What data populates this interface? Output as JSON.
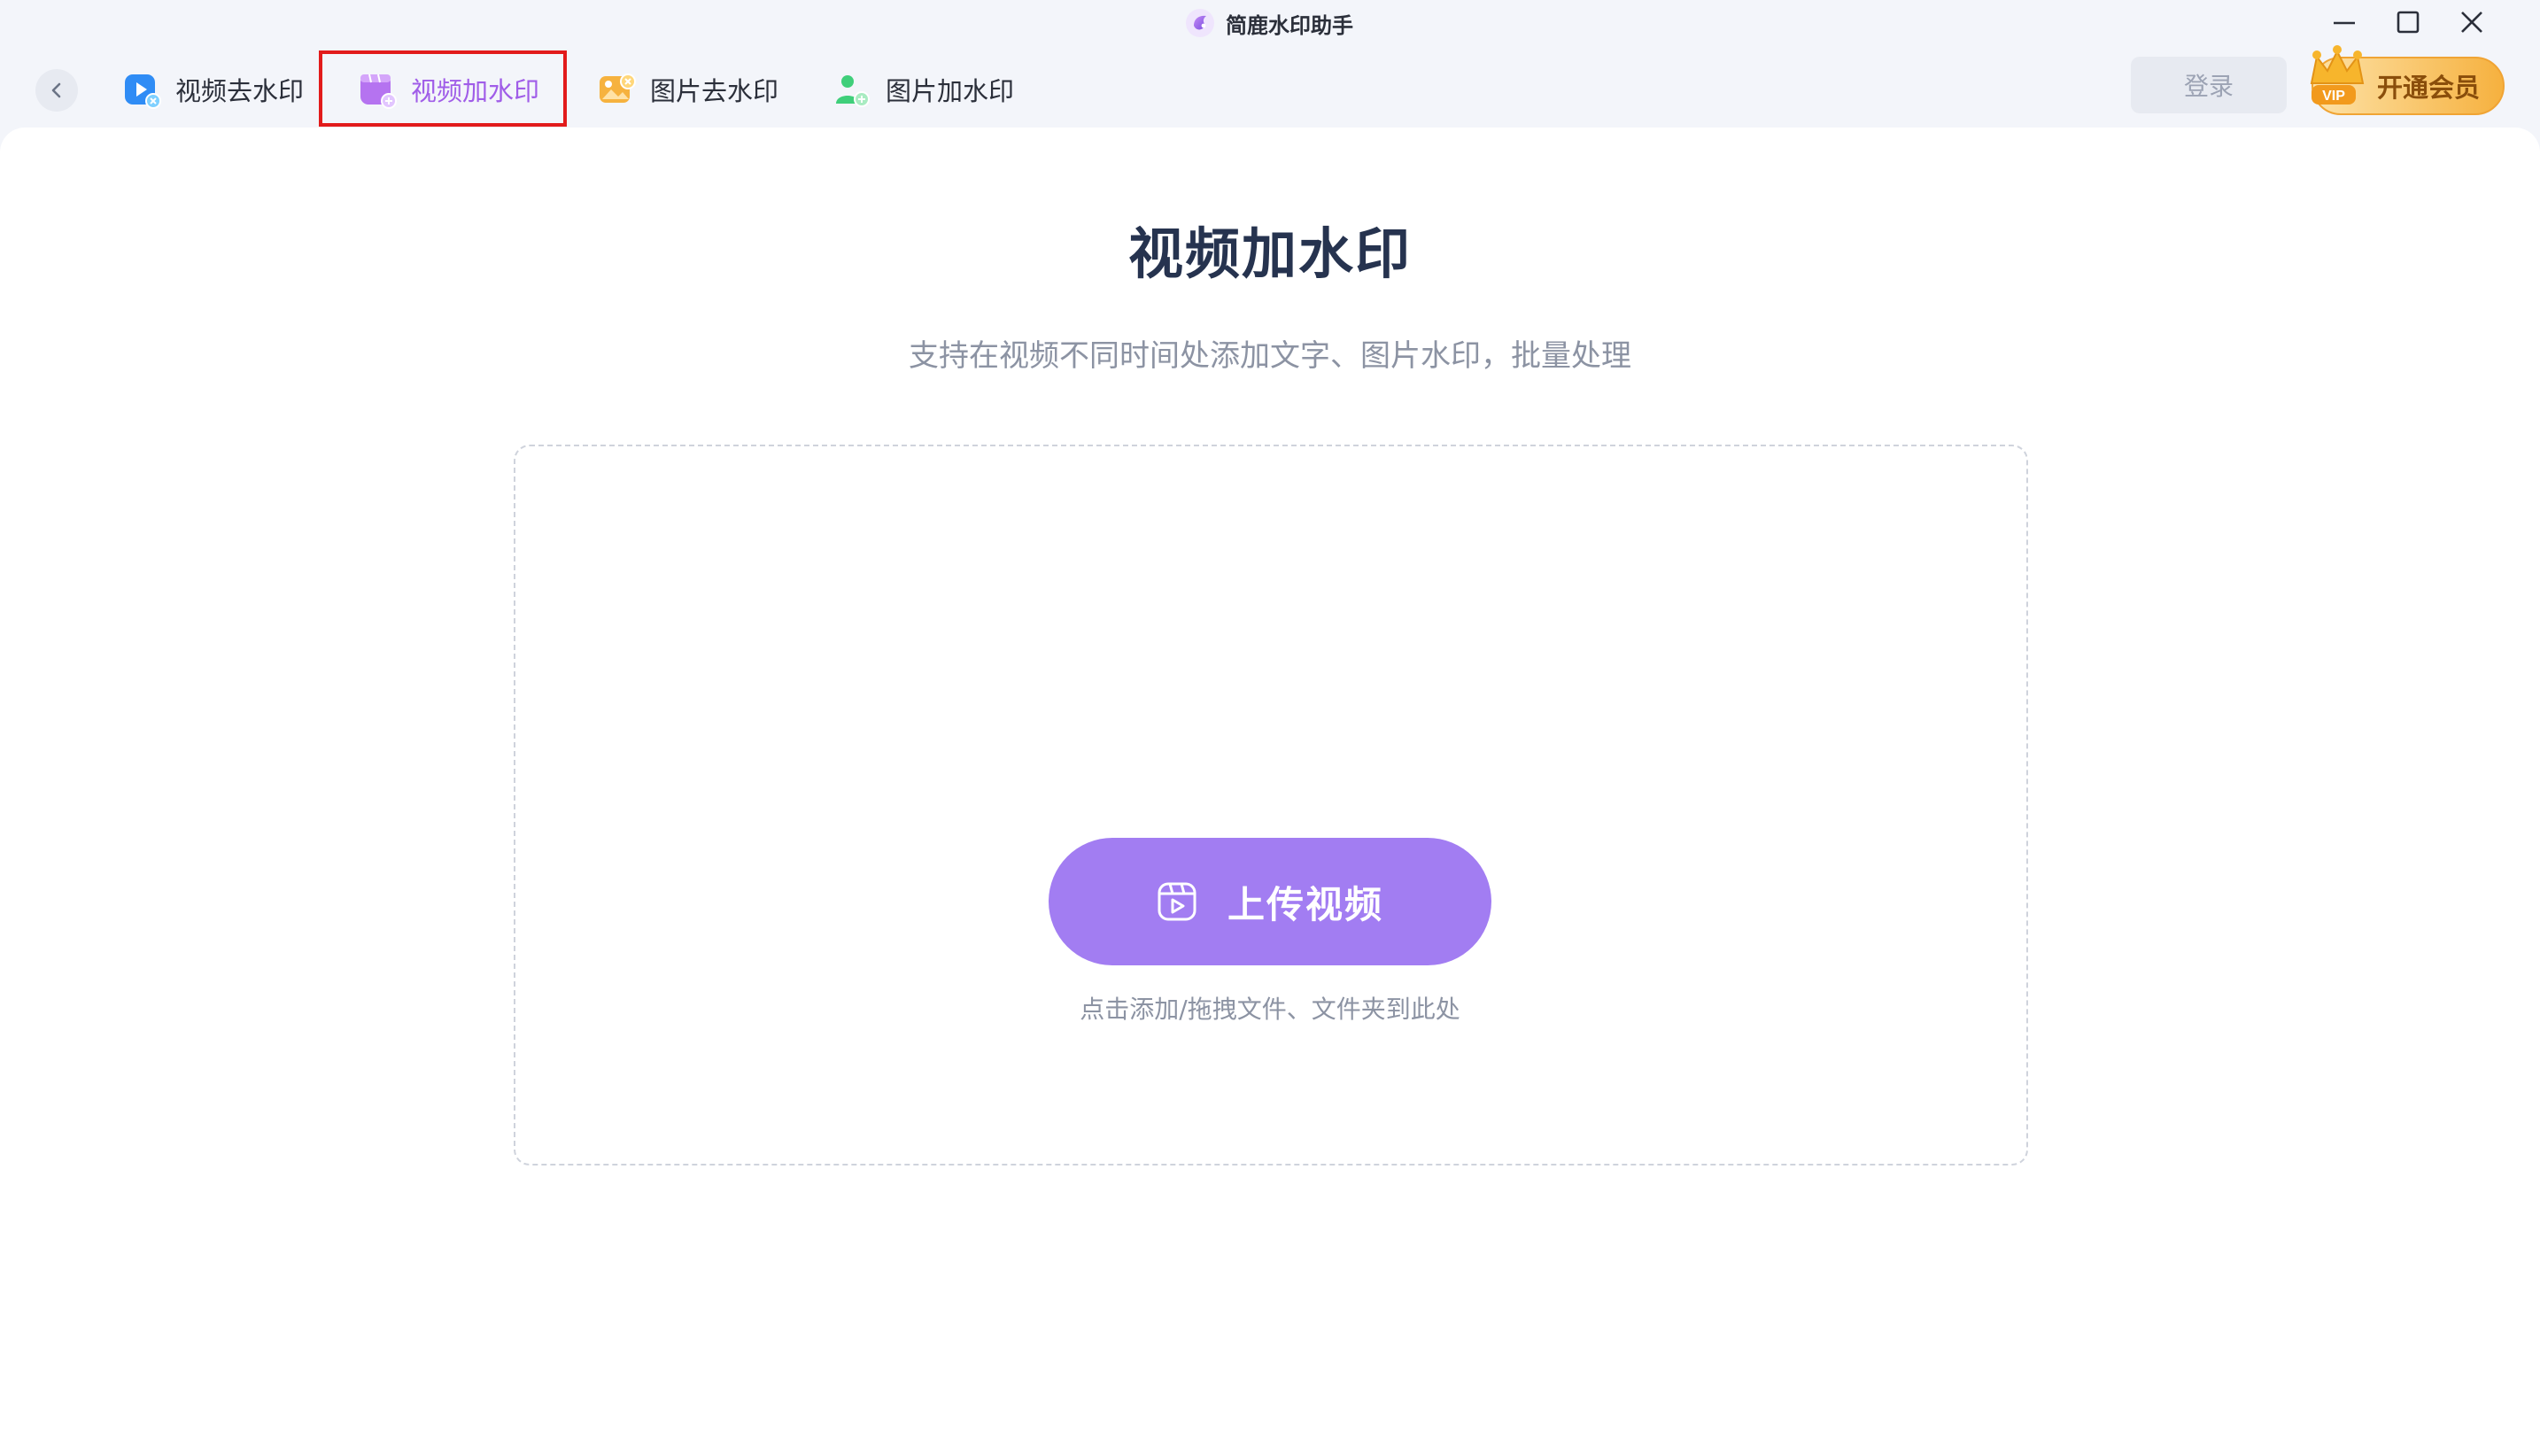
{
  "app": {
    "title": "简鹿水印助手"
  },
  "tabs": [
    {
      "label": "视频去水印",
      "icon": "video-remove-watermark-icon",
      "active": false
    },
    {
      "label": "视频加水印",
      "icon": "video-add-watermark-icon",
      "active": true
    },
    {
      "label": "图片去水印",
      "icon": "image-remove-watermark-icon",
      "active": false
    },
    {
      "label": "图片加水印",
      "icon": "image-add-watermark-icon",
      "active": false
    }
  ],
  "header": {
    "login_label": "登录",
    "vip_label": "开通会员",
    "vip_badge": "VIP"
  },
  "main": {
    "title": "视频加水印",
    "subtitle": "支持在视频不同时间处添加文字、图片水印，批量处理",
    "upload_label": "上传视频",
    "upload_hint": "点击添加/拖拽文件、文件夹到此处"
  },
  "colors": {
    "accent": "#a27df2",
    "active_tab": "#a05de8",
    "highlight": "#e21b1b",
    "vip_gold": "#f6b13f"
  }
}
